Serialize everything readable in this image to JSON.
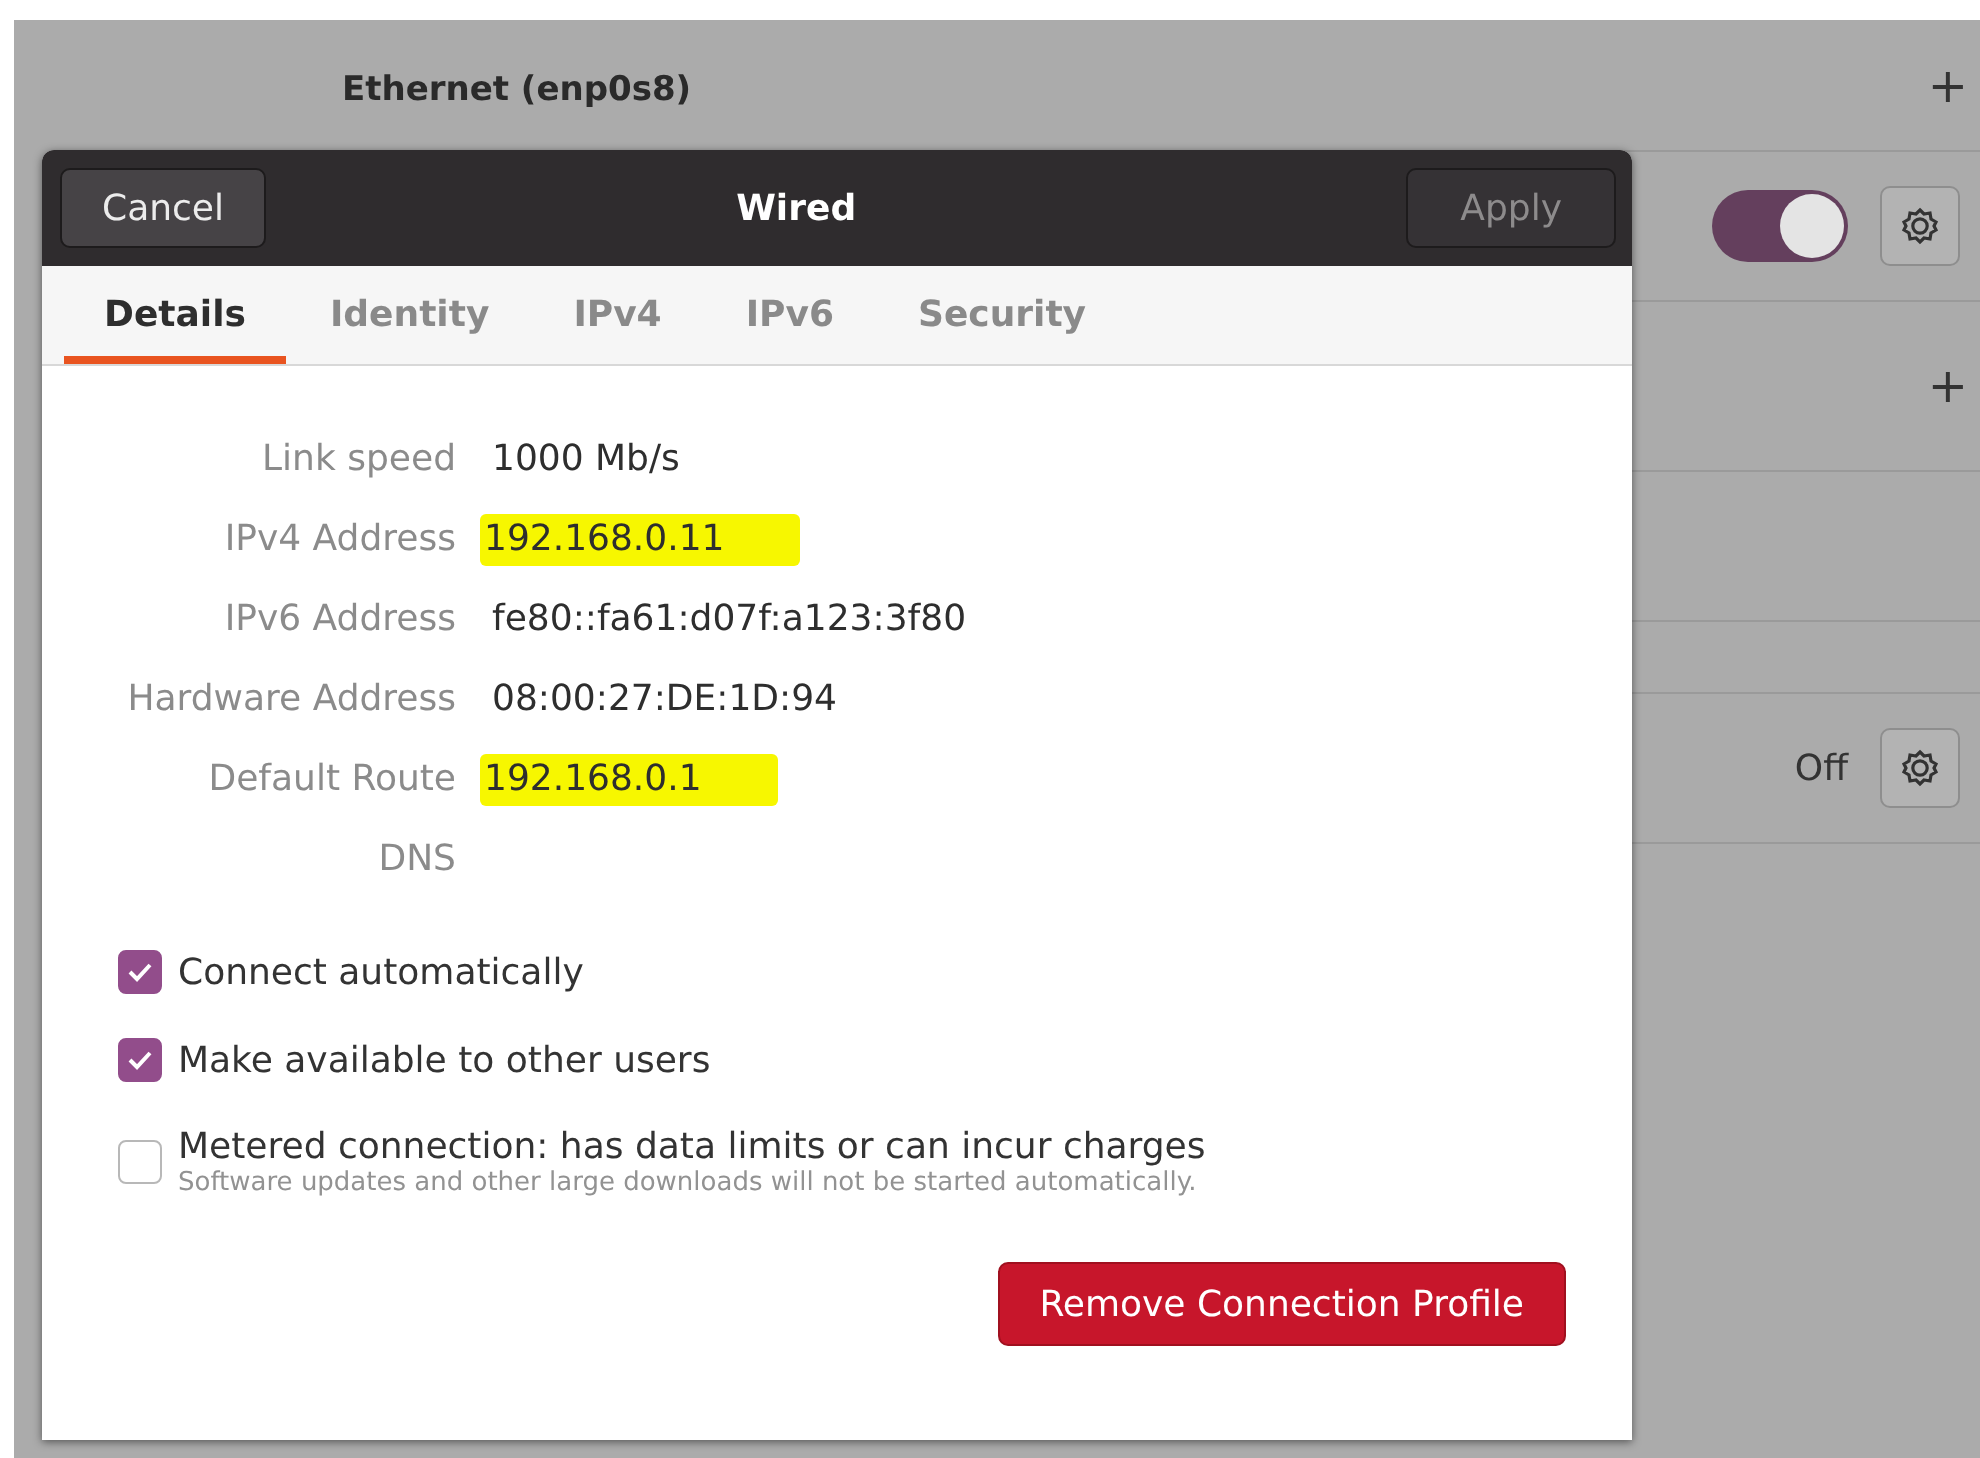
{
  "background": {
    "section_title": "Ethernet (enp0s8)",
    "add_button": "+",
    "second_add_button": "+",
    "connection_row": {
      "on": true
    },
    "other_row": {
      "status": "Off"
    }
  },
  "dialog": {
    "title": "Wired",
    "cancel": "Cancel",
    "apply": {
      "label": "Apply",
      "disabled": true
    },
    "tabs": [
      {
        "label": "Details",
        "selected": true
      },
      {
        "label": "Identity",
        "selected": false
      },
      {
        "label": "IPv4",
        "selected": false
      },
      {
        "label": "IPv6",
        "selected": false
      },
      {
        "label": "Security",
        "selected": false
      }
    ],
    "details": [
      {
        "label": "Link speed",
        "value": "1000 Mb/s",
        "highlighted": false
      },
      {
        "label": "IPv4 Address",
        "value": "192.168.0.11",
        "highlighted": true
      },
      {
        "label": "IPv6 Address",
        "value": "fe80::fa61:d07f:a123:3f80",
        "highlighted": false
      },
      {
        "label": "Hardware Address",
        "value": "08:00:27:DE:1D:94",
        "highlighted": false
      },
      {
        "label": "Default Route",
        "value": "192.168.0.1",
        "highlighted": true
      },
      {
        "label": "DNS"
      }
    ],
    "options": [
      {
        "label": "Connect automatically",
        "checked": true
      },
      {
        "label": "Make available to other users",
        "checked": true
      },
      {
        "label": "Metered connection: has data limits or can incur charges",
        "hint": "Software updates and other large downloads will not be started automatically.",
        "checked": false
      }
    ],
    "remove_button": "Remove Connection Profile"
  }
}
